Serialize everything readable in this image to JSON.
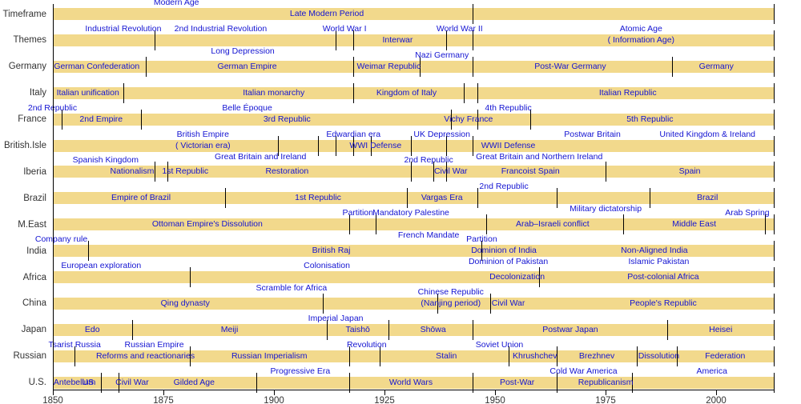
{
  "chart_data": {
    "type": "timeline",
    "title": "",
    "xlabel": "",
    "ylabel": "",
    "xlim": [
      1848,
      2014
    ],
    "grid": false,
    "legend": "none",
    "bar_color": "#f2d98c",
    "label_color": "#1414d2",
    "axis_color": "#333333",
    "x_ticks": [
      {
        "value": 1850,
        "label": "1850"
      },
      {
        "value": 1875,
        "label": "1875"
      },
      {
        "value": 1900,
        "label": "1900"
      },
      {
        "value": 1925,
        "label": "1925"
      },
      {
        "value": 1950,
        "label": "1950"
      },
      {
        "value": 1975,
        "label": "1975"
      },
      {
        "value": 2000,
        "label": "2000"
      }
    ],
    "rows": [
      {
        "name": "Timeframe",
        "start": 1850,
        "end": 2013,
        "dividers": [
          1945
        ],
        "labels_above": [
          {
            "text": "Modern Age",
            "x": 1878
          }
        ],
        "labels_on": [
          {
            "text": "Late Modern Period",
            "x": 1912
          }
        ],
        "labels_below": []
      },
      {
        "name": "Themes",
        "start": 1850,
        "end": 2013,
        "dividers": [
          1873,
          1914,
          1918,
          1939,
          1945
        ],
        "labels_above": [
          {
            "text": "Industrial Revolution",
            "x": 1866
          },
          {
            "text": "2nd Industrial Revolution",
            "x": 1888
          },
          {
            "text": "World War I",
            "x": 1916
          },
          {
            "text": "World War II",
            "x": 1942
          },
          {
            "text": "Atomic Age",
            "x": 1983
          }
        ],
        "labels_on": [
          {
            "text": "Interwar",
            "x": 1928
          },
          {
            "text": "( Information Age)",
            "x": 1983
          }
        ],
        "labels_below": [
          {
            "text": "Long Depression",
            "x": 1893
          }
        ]
      },
      {
        "name": "Germany",
        "start": 1850,
        "end": 2013,
        "dividers": [
          1871,
          1918,
          1933,
          1945,
          1990
        ],
        "labels_above": [
          {
            "text": "Nazi Germany",
            "x": 1938
          }
        ],
        "labels_on": [
          {
            "text": "German Confederation",
            "x": 1860
          },
          {
            "text": "German Empire",
            "x": 1894
          },
          {
            "text": "Weimar Republic",
            "x": 1926
          },
          {
            "text": "Post-War Germany",
            "x": 1967
          },
          {
            "text": "Germany",
            "x": 2000
          }
        ],
        "labels_below": []
      },
      {
        "name": "Italy",
        "start": 1850,
        "end": 2013,
        "dividers": [
          1866,
          1918,
          1943,
          1946
        ],
        "labels_above": [],
        "labels_on": [
          {
            "text": "Italian unification",
            "x": 1858
          },
          {
            "text": "Italian monarchy",
            "x": 1900
          },
          {
            "text": "Kingdom of Italy",
            "x": 1930
          },
          {
            "text": "Italian Republic",
            "x": 1980
          }
        ],
        "labels_below": []
      },
      {
        "name": "France",
        "start": 1850,
        "end": 2013,
        "dividers": [
          1852,
          1870,
          1940,
          1946,
          1958
        ],
        "labels_above": [
          {
            "text": "2nd Republic",
            "x": 1850
          },
          {
            "text": "Belle Époque",
            "x": 1894
          },
          {
            "text": "4th Republic",
            "x": 1953
          }
        ],
        "labels_on": [
          {
            "text": "2nd Empire",
            "x": 1861
          },
          {
            "text": "3rd Republic",
            "x": 1903
          },
          {
            "text": "Vichy France",
            "x": 1944
          },
          {
            "text": "5th Republic",
            "x": 1985
          }
        ],
        "labels_below": []
      },
      {
        "name": "British.Isle",
        "start": 1850,
        "end": 2013,
        "dividers": [
          1901,
          1910,
          1914,
          1918,
          1922,
          1931,
          1939,
          1945
        ],
        "labels_above": [
          {
            "text": "British Empire",
            "x": 1884
          },
          {
            "text": "Edwardian era",
            "x": 1918
          },
          {
            "text": "UK Depression",
            "x": 1938
          },
          {
            "text": "Postwar Britain",
            "x": 1972
          },
          {
            "text": "United Kingdom & Ireland",
            "x": 1998
          }
        ],
        "labels_on": [
          {
            "text": "( Victorian era)",
            "x": 1884
          },
          {
            "text": "WWI Defense",
            "x": 1923
          },
          {
            "text": "WWII Defense",
            "x": 1953
          }
        ],
        "labels_below": [
          {
            "text": "Great Britain and Ireland",
            "x": 1897
          },
          {
            "text": "Great Britain and Northern Ireland",
            "x": 1960
          }
        ]
      },
      {
        "name": "Iberia",
        "start": 1850,
        "end": 2013,
        "dividers": [
          1873,
          1876,
          1931,
          1936,
          1939,
          1975
        ],
        "labels_above": [
          {
            "text": "Spanish Kingdom",
            "x": 1862
          },
          {
            "text": "2nd Republic",
            "x": 1935
          }
        ],
        "labels_on": [
          {
            "text": "Nationalism",
            "x": 1868
          },
          {
            "text": "1st Republic",
            "x": 1880
          },
          {
            "text": "Restoration",
            "x": 1903
          },
          {
            "text": "Civil War",
            "x": 1940
          },
          {
            "text": "Francoist Spain",
            "x": 1958
          },
          {
            "text": "Spain",
            "x": 1994
          }
        ],
        "labels_below": []
      },
      {
        "name": "Brazil",
        "start": 1850,
        "end": 2013,
        "dividers": [
          1889,
          1930,
          1946,
          1964,
          1985
        ],
        "labels_above": [
          {
            "text": "2nd Republic",
            "x": 1952
          }
        ],
        "labels_on": [
          {
            "text": "Empire of Brazil",
            "x": 1870
          },
          {
            "text": "1st Republic",
            "x": 1910
          },
          {
            "text": "Vargas Era",
            "x": 1938
          },
          {
            "text": "Brazil",
            "x": 1998
          }
        ],
        "labels_below": [
          {
            "text": "Military dictatorship",
            "x": 1975
          }
        ]
      },
      {
        "name": "M.East",
        "start": 1850,
        "end": 2013,
        "dividers": [
          1917,
          1923,
          1948,
          1979,
          2011
        ],
        "labels_above": [
          {
            "text": "Partition",
            "x": 1919
          },
          {
            "text": "Mandatory Palestine",
            "x": 1931
          },
          {
            "text": "Arab Spring",
            "x": 2007
          }
        ],
        "labels_on": [
          {
            "text": "Ottoman Empire's Dissolution",
            "x": 1885
          },
          {
            "text": "Arab–Israeli conflict",
            "x": 1963
          },
          {
            "text": "Middle East",
            "x": 1995
          }
        ],
        "labels_below": [
          {
            "text": "French Mandate",
            "x": 1935
          }
        ]
      },
      {
        "name": "India",
        "start": 1850,
        "end": 2013,
        "dividers": [
          1858,
          1947
        ],
        "labels_above": [
          {
            "text": "Company rule",
            "x": 1852
          },
          {
            "text": "Partition",
            "x": 1947
          }
        ],
        "labels_on": [
          {
            "text": "British Raj",
            "x": 1913
          },
          {
            "text": "Dominion of India",
            "x": 1952
          },
          {
            "text": "Non-Aligned India",
            "x": 1986
          }
        ],
        "labels_below": [
          {
            "text": "Dominion of Pakistan",
            "x": 1953
          },
          {
            "text": "Islamic Pakistan",
            "x": 1987
          }
        ]
      },
      {
        "name": "Africa",
        "start": 1850,
        "end": 2013,
        "dividers": [
          1881,
          1960
        ],
        "labels_above": [
          {
            "text": "European exploration",
            "x": 1861
          },
          {
            "text": "Colonisation",
            "x": 1912
          }
        ],
        "labels_on": [
          {
            "text": "Decolonization",
            "x": 1955
          },
          {
            "text": "Post-colonial Africa",
            "x": 1988
          }
        ],
        "labels_below": [
          {
            "text": "Scramble for Africa",
            "x": 1904
          }
        ]
      },
      {
        "name": "China",
        "start": 1850,
        "end": 2013,
        "dividers": [
          1911,
          1937,
          1949
        ],
        "labels_above": [
          {
            "text": "Chinese Republic",
            "x": 1940
          }
        ],
        "labels_on": [
          {
            "text": "Qing dynasty",
            "x": 1880
          },
          {
            "text": "(Nanjing period)",
            "x": 1940
          },
          {
            "text": "Civil War",
            "x": 1953
          },
          {
            "text": "People's Republic",
            "x": 1988
          }
        ],
        "labels_below": []
      },
      {
        "name": "Japan",
        "start": 1850,
        "end": 2013,
        "dividers": [
          1868,
          1912,
          1926,
          1945,
          1989
        ],
        "labels_above": [
          {
            "text": "Imperial Japan",
            "x": 1914
          }
        ],
        "labels_on": [
          {
            "text": "Edo",
            "x": 1859
          },
          {
            "text": "Meiji",
            "x": 1890
          },
          {
            "text": "Taishō",
            "x": 1919
          },
          {
            "text": "Shōwa",
            "x": 1936
          },
          {
            "text": "Postwar Japan",
            "x": 1967
          },
          {
            "text": "Heisei",
            "x": 2001
          }
        ],
        "labels_below": []
      },
      {
        "name": "Russian",
        "start": 1850,
        "end": 2013,
        "dividers": [
          1855,
          1881,
          1917,
          1924,
          1953,
          1964,
          1982,
          1991
        ],
        "labels_above": [
          {
            "text": "Tsarist Russia",
            "x": 1855
          },
          {
            "text": "Russian Empire",
            "x": 1873
          },
          {
            "text": "Revolution",
            "x": 1921
          },
          {
            "text": "Soviet Union",
            "x": 1951
          }
        ],
        "labels_on": [
          {
            "text": "Reforms and reactionaries",
            "x": 1871
          },
          {
            "text": "Russian Imperialism",
            "x": 1899
          },
          {
            "text": "Stalin",
            "x": 1939
          },
          {
            "text": "Khrushchev",
            "x": 1959
          },
          {
            "text": "Brezhnev",
            "x": 1973
          },
          {
            "text": "Dissolution",
            "x": 1987
          },
          {
            "text": "Federation",
            "x": 2002
          }
        ],
        "labels_below": []
      },
      {
        "name": "U.S.",
        "start": 1850,
        "end": 2013,
        "dividers": [
          1861,
          1865,
          1896,
          1917,
          1945,
          1964,
          1981
        ],
        "labels_above": [
          {
            "text": "Progressive Era",
            "x": 1906
          },
          {
            "text": "Cold War America",
            "x": 1970
          },
          {
            "text": "America",
            "x": 1999
          }
        ],
        "labels_on": [
          {
            "text": "Antebellum",
            "x": 1855
          },
          {
            "text": "US",
            "x": 1858
          },
          {
            "text": "Civil War",
            "x": 1868
          },
          {
            "text": "Gilded Age",
            "x": 1882
          },
          {
            "text": "World Wars",
            "x": 1931
          },
          {
            "text": "Post-War",
            "x": 1955
          },
          {
            "text": "Republicanism",
            "x": 1975
          }
        ],
        "labels_below": []
      }
    ]
  }
}
